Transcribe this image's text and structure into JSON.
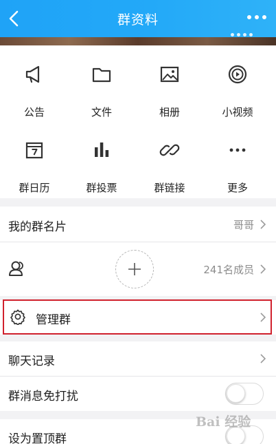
{
  "header": {
    "title": "群资料",
    "back_icon": "back-chevron-icon",
    "more_icon": "more-dots-icon",
    "bg_color": "#23a9f8"
  },
  "shortcuts": [
    {
      "label": "公告",
      "icon": "megaphone-icon"
    },
    {
      "label": "文件",
      "icon": "folder-icon"
    },
    {
      "label": "相册",
      "icon": "photo-album-icon"
    },
    {
      "label": "小视频",
      "icon": "video-play-icon"
    },
    {
      "label": "群日历",
      "icon": "calendar-icon"
    },
    {
      "label": "群投票",
      "icon": "bar-chart-icon"
    },
    {
      "label": "群链接",
      "icon": "link-icon"
    },
    {
      "label": "更多",
      "icon": "more-dots-icon"
    }
  ],
  "card": {
    "label": "我的群名片",
    "value": "哥哥"
  },
  "members": {
    "count_label": "241名成员",
    "add_icon": "plus-icon",
    "member_icon": "person-group-icon"
  },
  "manage": {
    "label": "管理群",
    "icon": "gear-icon",
    "highlight_color": "#d0202c"
  },
  "chat_history": {
    "label": "聊天记录"
  },
  "mute": {
    "label": "群消息免打扰",
    "enabled": false
  },
  "pin": {
    "label": "设为置顶群",
    "enabled": false
  },
  "watermark": "Bai 经验"
}
